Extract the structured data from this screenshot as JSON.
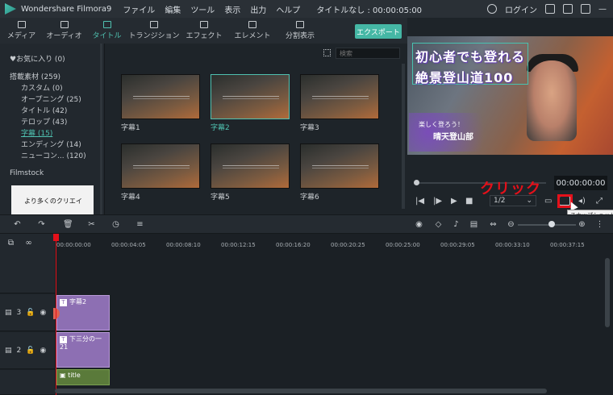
{
  "titlebar": {
    "app_name": "Wondershare Filmora9",
    "menu": [
      "ファイル",
      "編集",
      "ツール",
      "表示",
      "出力",
      "ヘルプ"
    ],
    "project_title": "タイトルなし : 00:00:05:00",
    "login_label": "ログイン"
  },
  "tabs": [
    {
      "label": "メディア",
      "icon": "folder-icon"
    },
    {
      "label": "オーディオ",
      "icon": "music-icon"
    },
    {
      "label": "タイトル",
      "icon": "text-icon",
      "active": true
    },
    {
      "label": "トランジション",
      "icon": "transition-icon"
    },
    {
      "label": "エフェクト",
      "icon": "effect-icon"
    },
    {
      "label": "エレメント",
      "icon": "element-icon"
    },
    {
      "label": "分割表示",
      "icon": "split-icon"
    }
  ],
  "export_label": "エクスポート",
  "sidebar": {
    "favorites": "♥お気に入り (0)",
    "builtin": "搭載素材 (259)",
    "items": [
      {
        "label": "カスタム (0)"
      },
      {
        "label": "オープニング (25)"
      },
      {
        "label": "タイトル (42)"
      },
      {
        "label": "テロップ (43)"
      },
      {
        "label": "字幕 (15)",
        "active": true
      },
      {
        "label": "エンディング (14)"
      },
      {
        "label": "ニューコン... (120)"
      }
    ],
    "filmstock": "Filmstock",
    "promo_text": "より多くのクリエイ"
  },
  "search": {
    "placeholder": "検索"
  },
  "thumbnails": [
    {
      "label": "字幕1"
    },
    {
      "label": "字幕2",
      "selected": true
    },
    {
      "label": "字幕3"
    },
    {
      "label": "字幕4"
    },
    {
      "label": "字幕5"
    },
    {
      "label": "字幕6"
    }
  ],
  "preview": {
    "title_line1": "初心者でも登れる",
    "title_line2": "絶景登山道100",
    "sub_small": "楽しく登ろう！",
    "sub_big": "晴天登山部"
  },
  "player": {
    "timecode": "00:00:00:00",
    "ratio": "1/2",
    "annotation": "クリック",
    "tooltip": "スナップショット"
  },
  "timeline": {
    "ticks": [
      "00:00:00:00",
      "00:00:04:05",
      "00:00:08:10",
      "00:00:12:15",
      "00:00:16:20",
      "00:00:20:25",
      "00:00:25:00",
      "00:00:29:05",
      "00:00:33:10",
      "00:00:37:15"
    ],
    "tracks": [
      {
        "num": "3",
        "clip": "字幕2"
      },
      {
        "num": "2",
        "clip": "下三分の一21"
      }
    ],
    "title_clip": "title"
  },
  "colors": {
    "accent": "#4fc1b0",
    "annotation_red": "#e4101a",
    "title_clip": "#8d6fb3"
  }
}
